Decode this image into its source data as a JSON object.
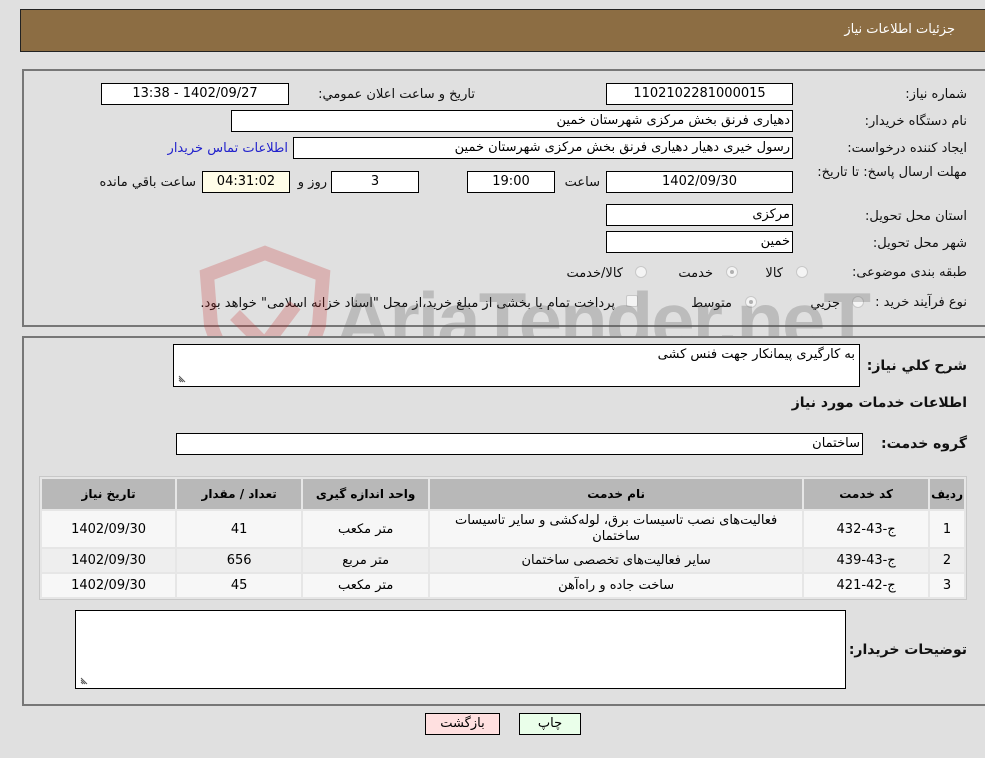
{
  "header": {
    "title": "جزئیات اطلاعات نیاز"
  },
  "details": {
    "need_number": {
      "label": "شماره نیاز:",
      "value": "1102102281000015"
    },
    "announce_datetime": {
      "label": "تاريخ و ساعت اعلان عمومي:",
      "value": "1402/09/27 - 13:38"
    },
    "buyer_org": {
      "label": "نام دستگاه خريدار:",
      "value": "دهیاری فرنق بخش مرکزی شهرستان خمین"
    },
    "requester": {
      "label": "ايجاد کننده درخواست:",
      "value": "رسول خیری دهیار دهیاری فرنق بخش مرکزی شهرستان خمین"
    },
    "contact_link": "اطلاعات تماس خريدار",
    "deadline": {
      "label": "مهلت ارسال پاسخ: تا تاريخ:",
      "date": "1402/09/30",
      "time_label": "ساعت",
      "time": "19:00",
      "days": "3",
      "days_label": "روز و",
      "remaining": "04:31:02",
      "remaining_label": "ساعت باقي مانده"
    },
    "province": {
      "label": "استان محل تحويل:",
      "value": "مرکزی"
    },
    "city": {
      "label": "شهر محل تحويل:",
      "value": "خمین"
    },
    "category": {
      "label": "طبقه بندی موضوعی:",
      "options": [
        "کالا",
        "خدمت",
        "کالا/خدمت"
      ],
      "selected": "خدمت"
    },
    "purchase_process": {
      "label": "نوع فرآيند خريد :",
      "options": [
        "جزيي",
        "متوسط"
      ],
      "selected": "متوسط",
      "treasury_note": "پرداخت تمام يا بخشی از مبلغ خريد،از محل \"اسناد خزانه اسلامی\" خواهد بود."
    }
  },
  "summary": {
    "label": "شرح کلي نياز:",
    "value": "به کارگیری پیمانکار جهت فنس کشی"
  },
  "services": {
    "section_title": "اطلاعات خدمات مورد نياز",
    "group_label": "گروه خدمت:",
    "group_value": "ساختمان",
    "table": {
      "headers": [
        "رديف",
        "کد خدمت",
        "نام خدمت",
        "واحد اندازه گيری",
        "تعداد / مقدار",
        "تاريخ نياز"
      ],
      "rows": [
        {
          "row": "1",
          "code": "ج-43-432",
          "name": "فعالیت‌های نصب تاسیسات برق، لوله‌کشی و سایر تاسیسات ساختمان",
          "unit": "متر مکعب",
          "qty": "41",
          "date": "1402/09/30"
        },
        {
          "row": "2",
          "code": "ج-43-439",
          "name": "سایر فعالیت‌های تخصصی ساختمان",
          "unit": "متر مربع",
          "qty": "656",
          "date": "1402/09/30"
        },
        {
          "row": "3",
          "code": "ج-42-421",
          "name": "ساخت جاده و راه‌آهن",
          "unit": "متر مکعب",
          "qty": "45",
          "date": "1402/09/30"
        }
      ]
    }
  },
  "buyer_notes": {
    "label": "توضيحات خريدار:",
    "value": ""
  },
  "buttons": {
    "print": "چاپ",
    "back": "بازگشت"
  },
  "watermark": {
    "text": "AriaTender.neT"
  },
  "colors": {
    "header_bg": "#8c6d43",
    "print_bg": "#eaffea",
    "back_bg": "#ffe0e0",
    "link": "#2222cc"
  }
}
